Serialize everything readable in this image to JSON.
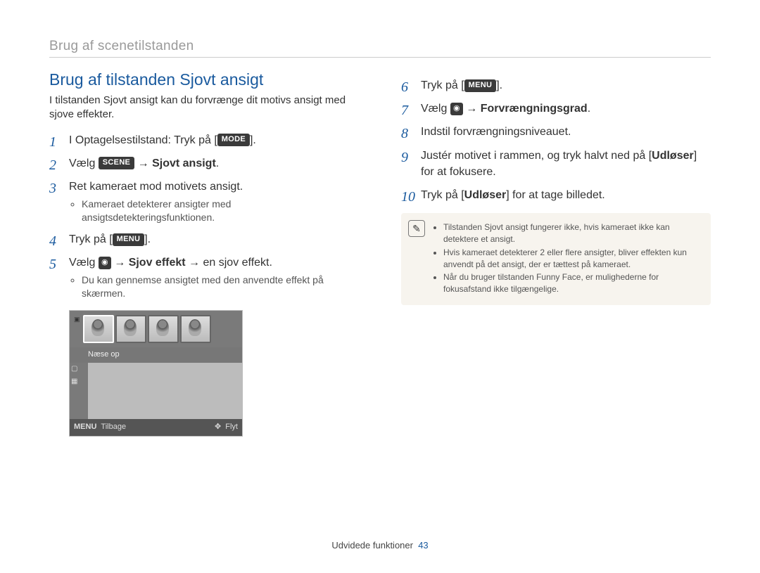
{
  "breadcrumb": "Brug af scenetilstanden",
  "section_title": "Brug af tilstanden Sjovt ansigt",
  "intro": "I tilstanden Sjovt ansigt kan du forvrænge dit motivs ansigt med sjove effekter.",
  "icons": {
    "mode": "MODE",
    "menu": "MENU",
    "scene": "SCENE",
    "camera": "◉"
  },
  "steps_left": {
    "s1_a": "I Optagelsestilstand: Tryk på [",
    "s1_b": "].",
    "s2_a": "Vælg ",
    "s2_arrow": " → ",
    "s2_b": "Sjovt ansigt",
    "s2_c": ".",
    "s3": "Ret kameraet mod motivets ansigt.",
    "s3_sub1": "Kameraet detekterer ansigter med ansigtsdetekteringsfunktionen.",
    "s4_a": "Tryk på [",
    "s4_b": "].",
    "s5_a": "Vælg ",
    "s5_arrow1": " → ",
    "s5_b": "Sjov effekt",
    "s5_arrow2": " → ",
    "s5_c": "en sjov effekt.",
    "s5_sub1": "Du kan gennemse ansigtet med den anvendte effekt på skærmen."
  },
  "steps_right": {
    "s6_a": "Tryk på [",
    "s6_b": "].",
    "s7_a": "Vælg ",
    "s7_arrow": " → ",
    "s7_b": "Forvrængningsgrad",
    "s7_c": ".",
    "s8": "Indstil forvrængningsniveauet.",
    "s9_a": "Justér motivet i rammen, og tryk halvt ned på [",
    "s9_b": "Udløser",
    "s9_c": "] for at fokusere.",
    "s10_a": "Tryk på [",
    "s10_b": "Udløser",
    "s10_c": "] for at tage billedet."
  },
  "notes": {
    "n1": "Tilstanden Sjovt ansigt fungerer ikke, hvis kameraet ikke kan detektere et ansigt.",
    "n2": "Hvis kameraet detekterer 2 eller flere ansigter, bliver effekten kun anvendt på det ansigt, der er tættest på kameraet.",
    "n3": "Når du bruger tilstanden Funny Face, er mulighederne for fokusafstand ikke tilgængelige."
  },
  "screenshot": {
    "effect_label": "Næse op",
    "menu_label": "MENU",
    "back_label": "Tilbage",
    "move_glyph": "✥",
    "move_label": "Flyt"
  },
  "footer": {
    "section": "Udvidede funktioner",
    "page": "43"
  }
}
